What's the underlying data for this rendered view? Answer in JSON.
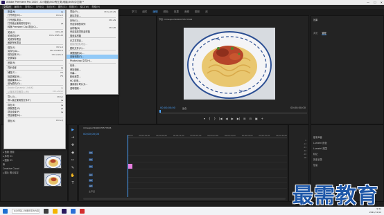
{
  "titlebar": {
    "title": "Adobe Premiere Pro 2020 - D:\\电脑\\500有五类\\电脑\\365\\中文版 *",
    "controls": [
      "—",
      "☐",
      "✕"
    ]
  },
  "menubar": {
    "items": [
      "文件(F)",
      "编辑(E)",
      "剪辑(C)",
      "序列(S)",
      "标记(M)",
      "图形(G)",
      "视图(V)",
      "窗口(W)",
      "帮助(H)"
    ]
  },
  "workspace": {
    "tabs": [
      "学习",
      "组件",
      "编辑",
      "颜色",
      "效果",
      "音频",
      "图形",
      "库"
    ],
    "active": "编辑"
  },
  "file_menu": {
    "items": [
      {
        "label": "新建(N)",
        "shortcut": "▶",
        "state": "hl"
      },
      {
        "label": "打开项目(O)...",
        "shortcut": "Ctrl+O",
        "state": ""
      },
      {
        "label": "打开团队项目...",
        "shortcut": "",
        "state": ""
      },
      {
        "label": "打开最近使用的内容(E)",
        "shortcut": "▶",
        "state": ""
      },
      {
        "label": "转换 Premiere Clip 项目(C)...",
        "shortcut": "",
        "state": ""
      },
      {
        "label": "关闭(C)",
        "shortcut": "Ctrl+W",
        "state": ""
      },
      {
        "label": "关闭项目(P)",
        "shortcut": "Ctrl+Shift+W",
        "state": ""
      },
      {
        "label": "关闭所有项目",
        "shortcut": "",
        "state": ""
      },
      {
        "label": "刷新所有项目",
        "shortcut": "",
        "state": ""
      },
      {
        "label": "保存(S)",
        "shortcut": "Ctrl+S",
        "state": ""
      },
      {
        "label": "另存为(A)...",
        "shortcut": "Ctrl+Shift+S",
        "state": ""
      },
      {
        "label": "保存副本(Y)...",
        "shortcut": "Ctrl+Alt+S",
        "state": ""
      },
      {
        "label": "全部保存",
        "shortcut": "",
        "state": ""
      },
      {
        "label": "还原(R)",
        "shortcut": "",
        "state": ""
      },
      {
        "label": "同步设置",
        "shortcut": "▶",
        "state": ""
      },
      {
        "label": "捕捉(T)...",
        "shortcut": "F5",
        "state": ""
      },
      {
        "label": "批量捕捉(B)...",
        "shortcut": "F6",
        "state": ""
      },
      {
        "label": "链接媒体(L)...",
        "shortcut": "",
        "state": ""
      },
      {
        "label": "设为脱机(O)...",
        "shortcut": "",
        "state": ""
      },
      {
        "label": "Adobe Dynamic Link(K)",
        "shortcut": "▶",
        "state": "dis"
      },
      {
        "label": "从媒体浏览器导入(M)",
        "shortcut": "Ctrl+Alt+I",
        "state": "dis"
      },
      {
        "label": "导入(I)...",
        "shortcut": "Ctrl+I",
        "state": ""
      },
      {
        "label": "导入最近使用的文件(F)",
        "shortcut": "▶",
        "state": ""
      },
      {
        "label": "导出(E)",
        "shortcut": "▶",
        "state": ""
      },
      {
        "label": "获取属性(G)",
        "shortcut": "▶",
        "state": ""
      },
      {
        "label": "项目设置(P)",
        "shortcut": "▶",
        "state": ""
      },
      {
        "label": "项目管理(M)...",
        "shortcut": "",
        "state": ""
      },
      {
        "label": "退出(X)",
        "shortcut": "Ctrl+Q",
        "state": ""
      }
    ]
  },
  "new_submenu": {
    "items": [
      {
        "label": "项目(P)...",
        "shortcut": "Ctrl+Alt+N",
        "state": ""
      },
      {
        "label": "团队项目...",
        "shortcut": "",
        "state": ""
      },
      {
        "label": "序列(S)...",
        "shortcut": "Ctrl+N",
        "state": ""
      },
      {
        "label": "来自剪辑的序列",
        "shortcut": "",
        "state": ""
      },
      {
        "label": "素材箱(B)",
        "shortcut": "Ctrl+B",
        "state": ""
      },
      {
        "label": "来自选择项的素材箱",
        "shortcut": "",
        "state": ""
      },
      {
        "label": "搜索素材箱",
        "shortcut": "",
        "state": ""
      },
      {
        "label": "已共享项目...",
        "shortcut": "",
        "state": ""
      },
      {
        "label": "链接的团队项目...",
        "shortcut": "",
        "state": "dis"
      },
      {
        "label": "脱机文件(O)...",
        "shortcut": "",
        "state": ""
      },
      {
        "label": "调整图层(A)...",
        "shortcut": "",
        "state": ""
      },
      {
        "label": "旧版标题(T)...",
        "shortcut": "",
        "state": "hl"
      },
      {
        "label": "Photoshop 文件(H)...",
        "shortcut": "",
        "state": ""
      },
      {
        "label": "彩条...",
        "shortcut": "",
        "state": ""
      },
      {
        "label": "黑场视频...",
        "shortcut": "",
        "state": ""
      },
      {
        "label": "字幕...",
        "shortcut": "",
        "state": ""
      },
      {
        "label": "颜色遮罩...",
        "shortcut": "",
        "state": ""
      },
      {
        "label": "HD 彩条...",
        "shortcut": "",
        "state": ""
      },
      {
        "label": "通用倒计时片头...",
        "shortcut": "",
        "state": ""
      },
      {
        "label": "透明视频...",
        "shortcut": "",
        "state": ""
      }
    ]
  },
  "program": {
    "filename": "节目: mmexport1602070577406",
    "tc_left": "00;00;00;00",
    "fit": "适合",
    "tc_right": "00;00;00;00",
    "transport": [
      "▾",
      "{",
      "}",
      "|◀",
      "◀",
      "▶",
      "▶|",
      "⊞",
      "⊟",
      "▣",
      "+"
    ]
  },
  "right": {
    "title": "效果",
    "tabs": [
      "浏览",
      "管理"
    ]
  },
  "project": {
    "items": [
      "▸ 音频 视频",
      "▸ 序列 01",
      "▸ 图像 01",
      "库",
      "Creative Cloud",
      "▸ 图片 照片库存"
    ]
  },
  "tools": [
    "▶",
    "⇥",
    "✥",
    "◆",
    "✂",
    "✎",
    "✋",
    "T"
  ],
  "timeline": {
    "name": "mmexport1602070577406",
    "timecode": "00;00;00;00",
    "ruler": [
      "00;00",
      "00;00;04;00",
      "00;00;08;00",
      "00;00;12;00",
      "00;00;16;00",
      "00;00;20;00",
      "00;00;24;00",
      "00;00;28;00",
      "00;00;32;00",
      "00;00;36;00"
    ],
    "tracks": [
      "V3",
      "V2",
      "V1",
      "A1",
      "A2",
      "A3",
      "主声道"
    ]
  },
  "meter": [
    "0",
    "-12",
    "-24",
    "-36",
    "-48",
    "dB"
  ],
  "effects_list": [
    "基本声音",
    "Lumetri 颜色",
    "Lumetri 范围",
    "标记",
    "历史记录",
    "信息"
  ],
  "watermark": "最需教育",
  "taskbar": {
    "search_placeholder": "在这里输入你要搜索的内容",
    "time": "9:31",
    "date": "2021/11/12"
  }
}
